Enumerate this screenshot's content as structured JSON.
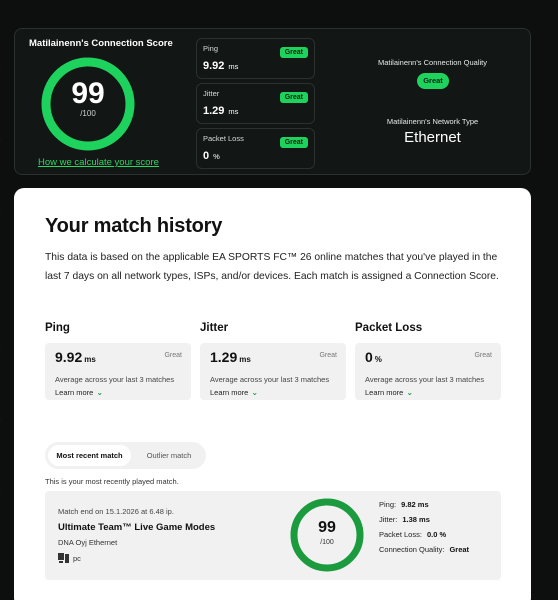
{
  "summary": {
    "score_title": "Matilainenn's Connection Score",
    "score": "99",
    "score_max": "/100",
    "score_fraction": 0.99,
    "calc_link": "How we calculate your score",
    "metrics": [
      {
        "label": "Ping",
        "value": "9.92",
        "unit": "ms",
        "badge": "Great"
      },
      {
        "label": "Jitter",
        "value": "1.29",
        "unit": "ms",
        "badge": "Great"
      },
      {
        "label": "Packet Loss",
        "value": "0",
        "unit": "%",
        "badge": "Great"
      }
    ],
    "quality_label": "Matilainenn's Connection Quality",
    "quality_value": "Great",
    "network_label": "Matilainenn's Network Type",
    "network_value": "Ethernet"
  },
  "history": {
    "title": "Your match history",
    "description": "This data is based on the applicable EA SPORTS FC™ 26 online matches that you've played in the last 7 days on all network types, ISPs, and/or devices. Each match is assigned a Connection Score.",
    "stats": [
      {
        "label": "Ping",
        "value": "9.92",
        "unit": "ms",
        "rating": "Great",
        "note": "Average across your last 3 matches",
        "more": "Learn more"
      },
      {
        "label": "Jitter",
        "value": "1.29",
        "unit": "ms",
        "rating": "Great",
        "note": "Average across your last 3 matches",
        "more": "Learn more"
      },
      {
        "label": "Packet Loss",
        "value": "0",
        "unit": "%",
        "rating": "Great",
        "note": "Average across your last 3 matches",
        "more": "Learn more"
      }
    ],
    "toggle": {
      "active": "Most recent match",
      "inactive": "Outlier match"
    },
    "recent_note": "This is your most recently played match.",
    "match": {
      "ended": "Match end on 15.1.2026 at 6.48 ip.",
      "mode": "Ultimate Team™ Live Game Modes",
      "isp": "DNA Oyj Ethernet",
      "platform": "pc",
      "score": "99",
      "score_max": "/100",
      "score_fraction": 0.99,
      "ping_label": "Ping:",
      "ping_value": "9.82 ms",
      "jitter_label": "Jitter:",
      "jitter_value": "1.38 ms",
      "loss_label": "Packet Loss:",
      "loss_value": "0.0 %",
      "quality_label": "Connection Quality:",
      "quality_value": "Great"
    }
  },
  "colors": {
    "accent_green": "#1ed35d",
    "match_ring_green": "#1b9a3e",
    "link_green": "#2fd466"
  },
  "icons": {
    "platform": "pc-monitor-icon",
    "expand": "chevron-down-icon"
  }
}
